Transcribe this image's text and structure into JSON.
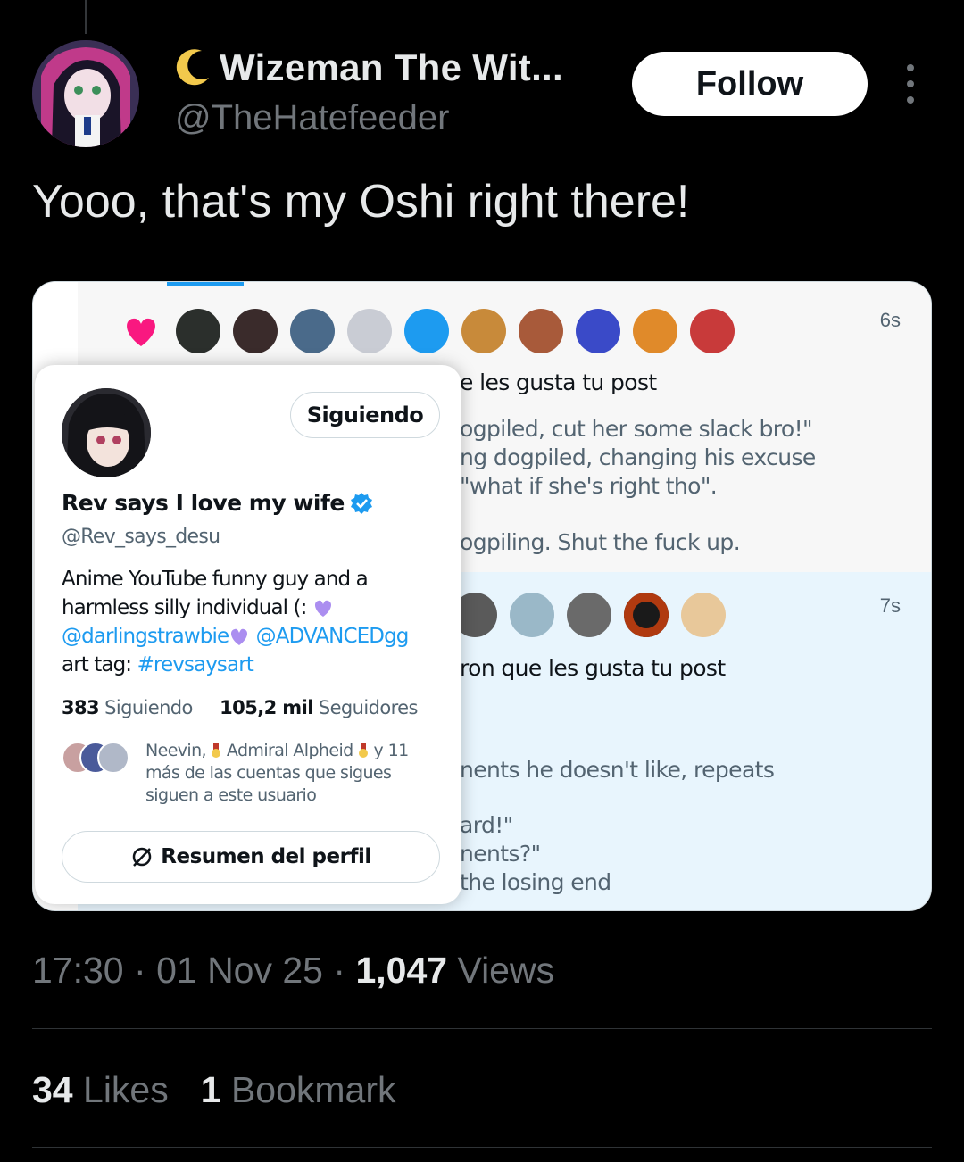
{
  "author": {
    "display_name": "Wizeman The Wit...",
    "handle": "@TheHatefeeder",
    "moon_icon": "crescent-moon-icon"
  },
  "actions": {
    "follow_label": "Follow"
  },
  "tweet": {
    "text": "Yooo, that's my Oshi right there!"
  },
  "embedded": {
    "row_a": {
      "time": "6s",
      "lines": [
        "e les gusta tu post",
        "ogpiled, cut her some slack bro!\"",
        "ng dogpiled, changing his excuse",
        "\"what if she's right tho\".",
        "ogpiling. Shut the fuck up."
      ]
    },
    "row_b": {
      "time": "7s",
      "lines": [
        "ron que les gusta tu post",
        "nents he doesn't like, repeats",
        "ard!\"",
        "nents?\"",
        "the losing end"
      ]
    },
    "card": {
      "following_button": "Siguiendo",
      "name": "Rev says I love my wife",
      "handle": "@Rev_says_desu",
      "bio_line1": "Anime YouTube funny guy and a",
      "bio_line2": "harmless silly individual (:",
      "bio_link1": "@darlingstrawbie",
      "bio_link2": "@ADVANCEDgg",
      "bio_art_label": "art tag:",
      "bio_art_tag": "#revsaysart",
      "following_count": "383",
      "following_label": "Siguiendo",
      "followers_count": "105,2 mil",
      "followers_label": "Seguidores",
      "mutual_name1": "Neevin,",
      "mutual_name2": "Admiral Alpheid",
      "mutual_more": "y 11",
      "mutual_rest": "más de las cuentas que sigues siguen a este usuario",
      "summary_button": "Resumen del perfil"
    }
  },
  "meta": {
    "time": "17:30",
    "date": "01 Nov 25",
    "views_count": "1,047",
    "views_label": "Views",
    "sep": "·"
  },
  "engagement": {
    "likes_count": "34",
    "likes_label": "Likes",
    "bookmarks_count": "1",
    "bookmarks_label": "Bookmark"
  },
  "colors": {
    "background": "#000000",
    "accent": "#1d9bf0",
    "heart": "#f91880",
    "verified": "#1d9bf0",
    "heart_purple": "#ab8ef0"
  }
}
